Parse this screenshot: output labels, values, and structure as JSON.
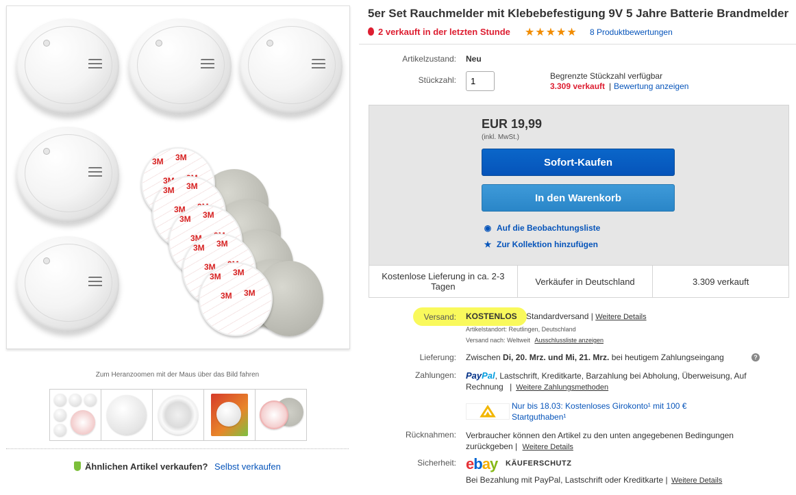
{
  "title": "5er Set Rauchmelder mit Klebebefestigung 9V 5 Jahre Batterie Brandmelder",
  "sold_last_hour": "2 verkauft in der letzten Stunde",
  "rating_stars": 5,
  "reviews_link": "8 Produktbewertungen",
  "gallery": {
    "zoom_hint": "Zum Heranzoomen mit der Maus über das Bild fahren",
    "sticker_text": "3M"
  },
  "sell_similar": {
    "label": "Ähnlichen Artikel verkaufen?",
    "link": "Selbst verkaufen"
  },
  "condition": {
    "label": "Artikelzustand:",
    "value": "Neu"
  },
  "quantity": {
    "label": "Stückzahl:",
    "value": "1",
    "limited": "Begrenzte Stückzahl verfügbar",
    "sold": "3.309 verkauft",
    "separator": "|",
    "rating_link": "Bewertung anzeigen"
  },
  "buybox": {
    "price": "EUR 19,99",
    "vat": "(inkl. MwSt.)",
    "buy_now": "Sofort-Kaufen",
    "add_cart": "In den Warenkorb",
    "watch": "Auf die Beobachtungsliste",
    "collection": "Zur Kollektion hinzufügen",
    "info": [
      "Kostenlose Lieferung in ca. 2-3 Tagen",
      "Verkäufer in Deutschland",
      "3.309 verkauft"
    ]
  },
  "shipping": {
    "label": "Versand:",
    "value": "KOSTENLOS",
    "method": "Standardversand |",
    "details_link": "Weitere Details",
    "location_label": "Artikelstandort:",
    "location": "Reutlingen, Deutschland",
    "ships_to_label": "Versand nach:",
    "ships_to": "Weltweit",
    "exclusions_link": "Ausschlussliste anzeigen"
  },
  "delivery": {
    "label": "Lieferung:",
    "pre": "Zwischen",
    "dates": "Di, 20. Mrz. und Mi, 21. Mrz.",
    "post": "bei heutigem Zahlungseingang",
    "help": "?"
  },
  "payments": {
    "label": "Zahlungen:",
    "paypal_a": "Pay",
    "paypal_b": "Pal",
    "methods": ", Lastschrift, Kreditkarte, Barzahlung bei Abholung, Überweisung, Auf Rechnung",
    "sep": "|",
    "link": "Weitere Zahlungsmethoden",
    "promo": "Nur bis 18.03: Kostenloses Girokonto¹ mit 100 € Startguthaben¹"
  },
  "returns": {
    "label": "Rücknahmen:",
    "text": "Verbraucher können den Artikel zu den unten angegebenen Bedingungen zurückgeben |",
    "link": "Weitere Details"
  },
  "security": {
    "label": "Sicherheit:",
    "logo": [
      "e",
      "b",
      "a",
      "y"
    ],
    "badge": "KÄUFERSCHUTZ",
    "text": "Bei Bezahlung mit PayPal, Lastschrift oder Kreditkarte |",
    "link": "Weitere Details"
  },
  "colors": {
    "accent_blue": "#0654ba",
    "sold_red": "#dd1e31",
    "star_orange": "#f18c00",
    "highlight": "#f8f84a"
  }
}
